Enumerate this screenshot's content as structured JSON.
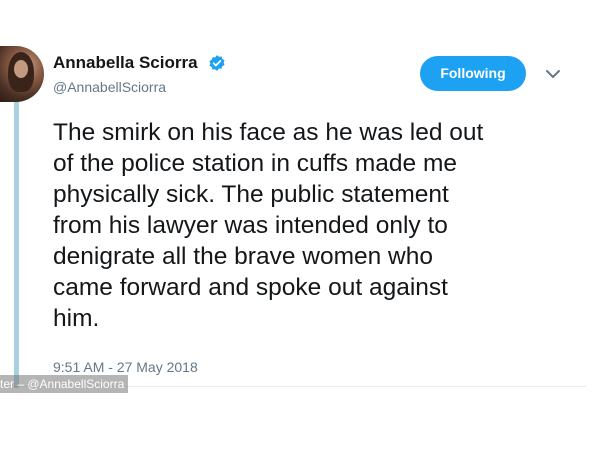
{
  "tweet": {
    "author": {
      "display_name": "Annabella Sciorra",
      "handle": "@AnnabellSciorra",
      "verified": true,
      "avatar_icon": "avatar"
    },
    "follow_button_label": "Following",
    "menu_icon": "chevron-down-icon",
    "text_lines": [
      "The smirk on his face as he was led out",
      "of the police station in cuffs made me",
      "physically sick. The public statement",
      "from his lawyer was intended only to",
      "denigrate all the brave women who",
      "came forward and spoke out against",
      "him."
    ],
    "timestamp": "9:51 AM - 27 May 2018"
  },
  "photo_credit": "ter – @AnnabellSciorra",
  "colors": {
    "accent": "#1da1f2",
    "text_primary": "#14171a",
    "text_secondary": "#657786",
    "rule": "#a8d0e0"
  }
}
